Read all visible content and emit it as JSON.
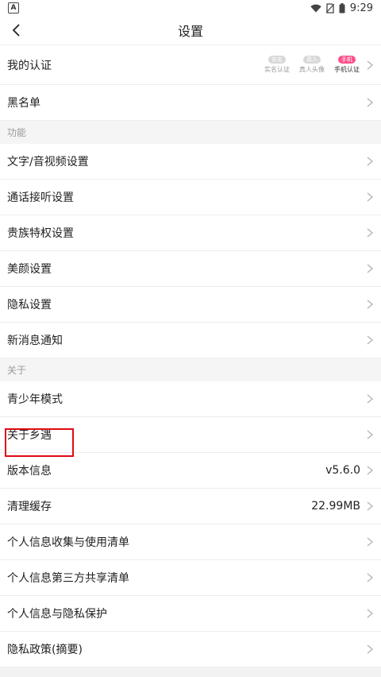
{
  "status": {
    "time": "9:29",
    "a_icon": "A"
  },
  "header": {
    "title": "设置"
  },
  "rows_top": [
    {
      "label": "我的认证"
    },
    {
      "label": "黑名单"
    }
  ],
  "auth": [
    {
      "icon": "实名",
      "caption": "实名认证"
    },
    {
      "icon": "真人",
      "caption": "真人头像"
    },
    {
      "icon": "手机",
      "caption": "手机认证"
    }
  ],
  "section_function": {
    "label": "功能"
  },
  "function_items": [
    {
      "label": "文字/音视频设置"
    },
    {
      "label": "通话接听设置"
    },
    {
      "label": "贵族特权设置"
    },
    {
      "label": "美颜设置"
    },
    {
      "label": "隐私设置"
    },
    {
      "label": "新消息通知"
    }
  ],
  "section_about": {
    "label": "关于"
  },
  "about_items": [
    {
      "label": "青少年模式"
    },
    {
      "label": "关于乡遇"
    },
    {
      "label": "版本信息",
      "value": "v5.6.0"
    },
    {
      "label": "清理缓存",
      "value": "22.99MB"
    },
    {
      "label": "个人信息收集与使用清单"
    },
    {
      "label": "个人信息第三方共享清单"
    },
    {
      "label": "个人信息与隐私保护"
    },
    {
      "label": "隐私政策(摘要)"
    }
  ],
  "colors": {
    "highlight": "#e00b13",
    "accent_pink": "#ff4f8b"
  }
}
